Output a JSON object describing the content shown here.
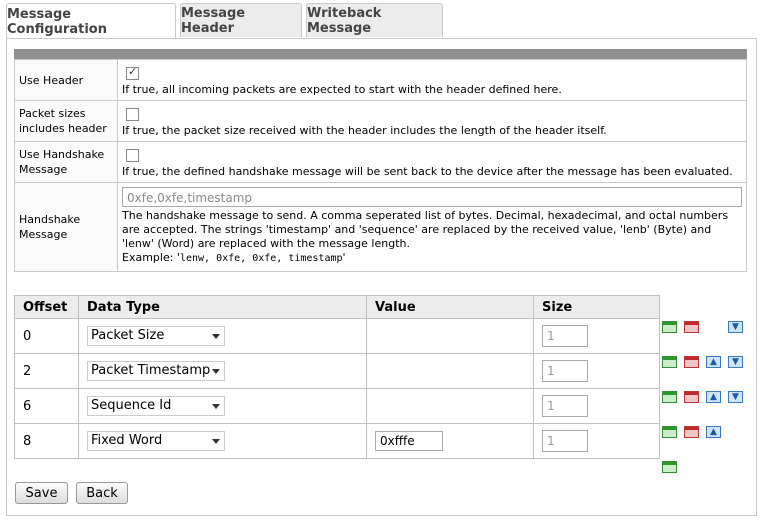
{
  "tabs": [
    {
      "label": "Message Configuration"
    },
    {
      "label": "Message Header"
    },
    {
      "label": "Writeback Message"
    }
  ],
  "config": {
    "use_header": {
      "label": "Use Header",
      "checked": true,
      "description": "If true, all incoming packets are expected to start with the header defined here."
    },
    "packet_sizes": {
      "label": "Packet sizes includes header",
      "checked": false,
      "description": "If true, the packet size received with the header includes the length of the header itself."
    },
    "use_handshake": {
      "label": "Use Handshake Message",
      "checked": false,
      "description": "If true, the defined handshake message will be sent back to the device after the message has been evaluated."
    },
    "handshake": {
      "label": "Handshake Message",
      "placeholder": "0xfe,0xfe,timestamp",
      "description": "The handshake message to send. A comma seperated list of bytes. Decimal, hexadecimal, and octal numbers are accepted. The strings 'timestamp' and 'sequence' are replaced by the received value, 'lenb' (Byte) and 'lenw' (Word) are replaced with the message length.",
      "example_prefix": "Example: '",
      "example_code": "lenw, 0xfe, 0xfe, timestamp",
      "example_suffix": "'"
    }
  },
  "grid": {
    "headers": {
      "offset": "Offset",
      "data_type": "Data Type",
      "value": "Value",
      "size": "Size"
    },
    "rows": [
      {
        "offset": "0",
        "data_type": "Packet Size",
        "value": "",
        "size": "1"
      },
      {
        "offset": "2",
        "data_type": "Packet Timestamp",
        "value": "",
        "size": "1"
      },
      {
        "offset": "6",
        "data_type": "Sequence Id",
        "value": "",
        "size": "1"
      },
      {
        "offset": "8",
        "data_type": "Fixed Word",
        "value": "0xfffe",
        "size": "1"
      }
    ]
  },
  "buttons": {
    "save": "Save",
    "back": "Back"
  },
  "icons": {
    "add_row": "add-row-icon",
    "delete_row": "delete-row-icon",
    "move_up": "move-up-icon",
    "move_down": "move-down-icon"
  }
}
